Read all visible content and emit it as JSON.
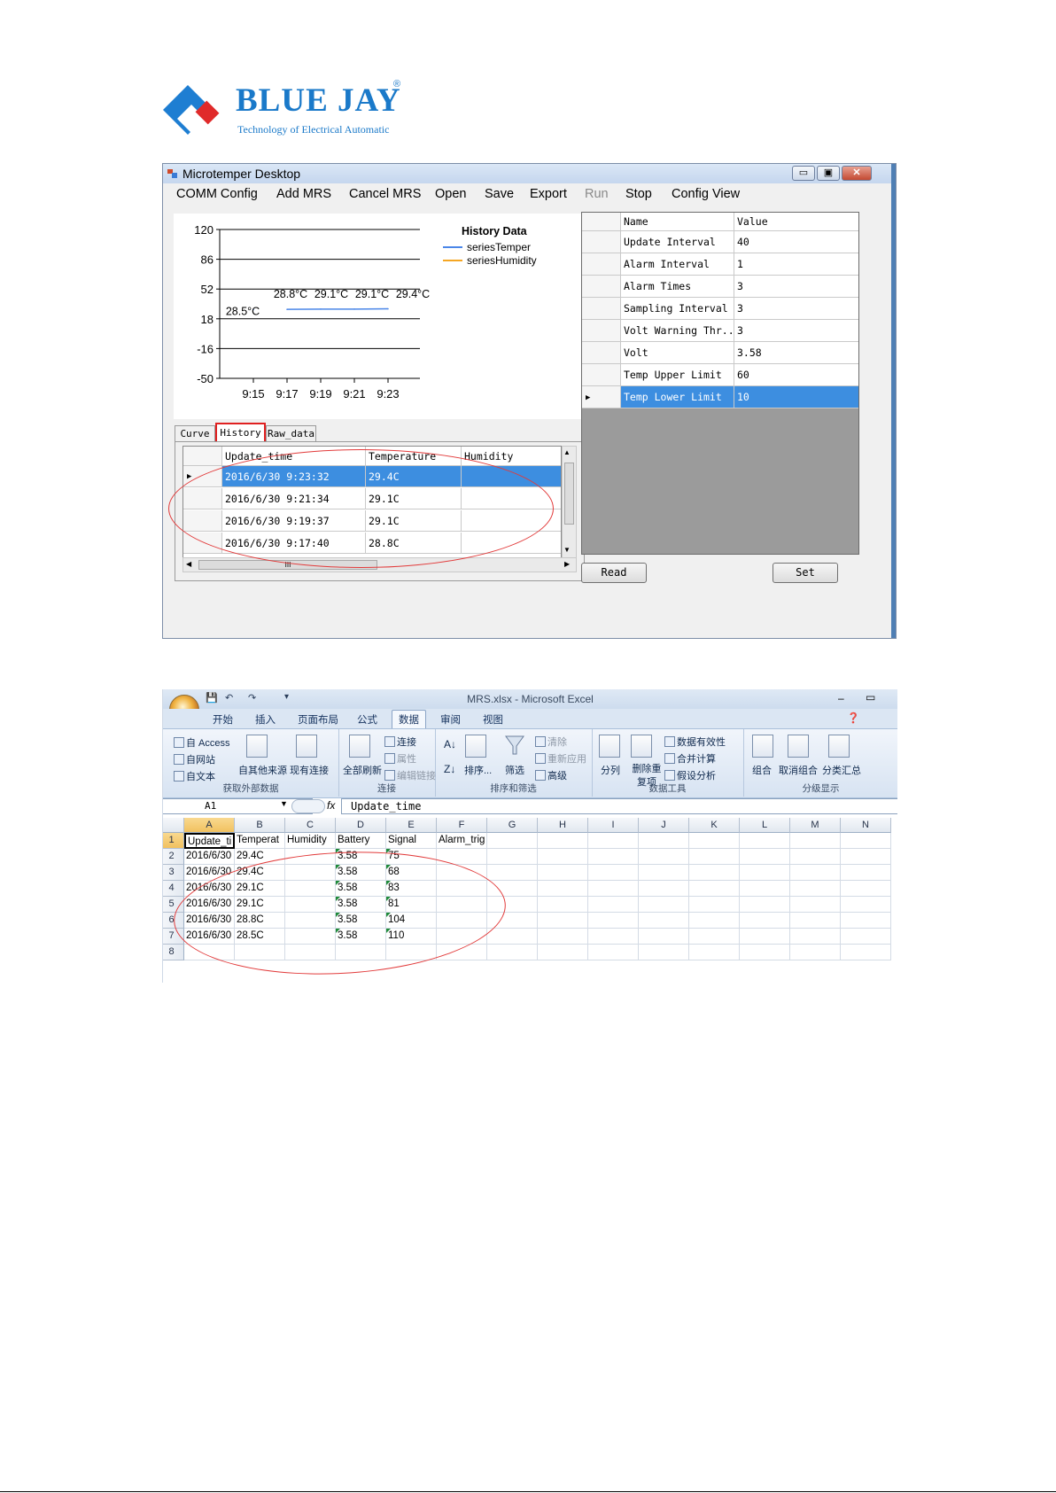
{
  "logo": {
    "brand": "BLUE JAY",
    "registered": "®",
    "tagline": "Technology of Electrical Automatic"
  },
  "app": {
    "title": "Microtemper Desktop",
    "menu": [
      "COMM Config",
      "Add MRS",
      "Cancel MRS",
      "Open",
      "Save",
      "Export",
      "Run",
      "Stop",
      "Config View"
    ],
    "menu_disabled": [
      "Run"
    ],
    "tabs": [
      "Curve",
      "History",
      "Raw_data"
    ],
    "active_tab": "History",
    "history": {
      "columns": [
        "Update_time",
        "Temperature",
        "Humidity"
      ],
      "rows": [
        [
          "2016/6/30 9:23:32",
          "29.4C",
          ""
        ],
        [
          "2016/6/30 9:21:34",
          "29.1C",
          ""
        ],
        [
          "2016/6/30 9:19:37",
          "29.1C",
          ""
        ],
        [
          "2016/6/30 9:17:40",
          "28.8C",
          ""
        ]
      ],
      "selected_row": 0,
      "hscroll_thumb": "III"
    },
    "config": {
      "columns": [
        "Name",
        "Value"
      ],
      "rows": [
        [
          "Update Interval",
          "40"
        ],
        [
          "Alarm Interval",
          "1"
        ],
        [
          "Alarm Times",
          "3"
        ],
        [
          "Sampling Interval",
          "3"
        ],
        [
          "Volt Warning Thr...",
          "3"
        ],
        [
          "Volt",
          "3.58"
        ],
        [
          "Temp Upper Limit",
          "60"
        ],
        [
          "Temp Lower Limit",
          "10"
        ]
      ],
      "selected_row": 7
    },
    "buttons": {
      "read": "Read",
      "set": "Set"
    }
  },
  "chart_data": {
    "type": "line",
    "title": "History Data",
    "x": [
      "9:15",
      "9:17",
      "9:19",
      "9:21",
      "9:23"
    ],
    "yticks": [
      120,
      86,
      52,
      18,
      -16,
      -50
    ],
    "ylim": [
      -50,
      120
    ],
    "series": [
      {
        "name": "seriesTemper",
        "color": "#4a86e8",
        "values": [
          28.5,
          28.8,
          29.1,
          29.1,
          29.4
        ]
      },
      {
        "name": "seriesHumidity",
        "color": "#f5a623",
        "values": []
      }
    ],
    "point_labels": [
      "28.5°C",
      "28.8°C",
      "29.1°C",
      "29.1°C",
      "29.4°C"
    ],
    "legend": "top-right",
    "grid": true
  },
  "excel": {
    "title": "MRS.xlsx - Microsoft Excel",
    "tabs": [
      "开始",
      "插入",
      "页面布局",
      "公式",
      "数据",
      "审阅",
      "视图"
    ],
    "active_tab": "数据",
    "window_controls": [
      "–",
      "▭"
    ],
    "groups": {
      "external": {
        "label": "获取外部数据",
        "items": [
          "自 Access",
          "自网站",
          "自文本",
          "自其他来源",
          "现有连接"
        ]
      },
      "connections": {
        "label": "连接",
        "items": [
          "全部刷新",
          "连接",
          "属性",
          "编辑链接"
        ]
      },
      "sort": {
        "label": "排序和筛选",
        "items": [
          "排序...",
          "筛选",
          "清除",
          "重新应用",
          "高级"
        ]
      },
      "datatools": {
        "label": "数据工具",
        "items": [
          "分列",
          "删除重复项",
          "数据有效性",
          "合并计算",
          "假设分析"
        ]
      },
      "outline": {
        "label": "分级显示",
        "items": [
          "组合",
          "取消组合",
          "分类汇总"
        ]
      }
    },
    "name_box": "A1",
    "formula": "Update_time",
    "columns": [
      "A",
      "B",
      "C",
      "D",
      "E",
      "F",
      "G",
      "H",
      "I",
      "J",
      "K",
      "L",
      "M",
      "N"
    ],
    "rows": [
      [
        "Update_ti",
        "Temperat",
        "Humidity",
        "Battery",
        "Signal",
        "Alarm_trig"
      ],
      [
        "2016/6/30",
        "29.4C",
        "",
        "3.58",
        "75",
        ""
      ],
      [
        "2016/6/30",
        "29.4C",
        "",
        "3.58",
        "68",
        ""
      ],
      [
        "2016/6/30",
        "29.1C",
        "",
        "3.58",
        "83",
        ""
      ],
      [
        "2016/6/30",
        "29.1C",
        "",
        "3.58",
        "81",
        ""
      ],
      [
        "2016/6/30",
        "28.8C",
        "",
        "3.58",
        "104",
        ""
      ],
      [
        "2016/6/30",
        "28.5C",
        "",
        "3.58",
        "110",
        ""
      ],
      [
        "",
        "",
        "",
        "",
        "",
        ""
      ]
    ]
  }
}
